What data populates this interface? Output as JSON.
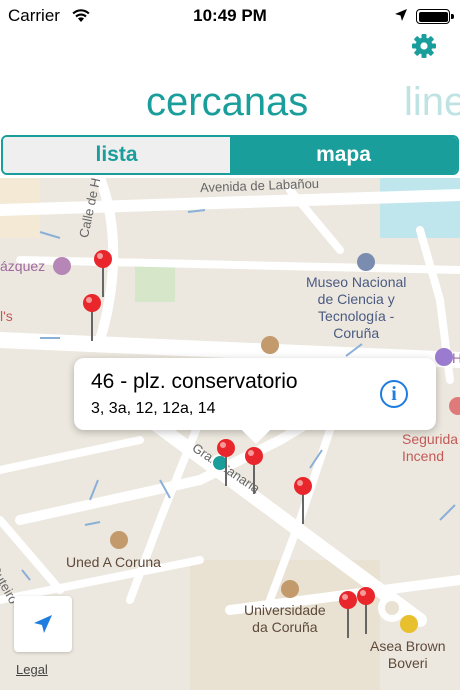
{
  "status_bar": {
    "carrier": "Carrier",
    "time": "10:49 PM"
  },
  "header": {
    "tab_current": "cercanas",
    "tab_next": "line",
    "settings_icon": "gear-icon"
  },
  "segmented": {
    "lista": "lista",
    "mapa": "mapa",
    "selected": "mapa"
  },
  "map": {
    "streets": [
      "Avenida de Labañou",
      "Calle de Honduras",
      "Gran Canaria",
      "Outeiro"
    ],
    "pois": [
      {
        "name": "Museo Nacional\nde Ciencia y\nTecnología -\nCoruña"
      },
      {
        "name": "Uned A Coruna"
      },
      {
        "name": "Universidade\nda Coruña"
      },
      {
        "name": "Asea Brown\nBoveri"
      },
      {
        "name": "Galle\nSegurida\nIncend"
      },
      {
        "name": "ázquez"
      },
      {
        "name": "l's"
      },
      {
        "name": "H"
      }
    ],
    "callout": {
      "title": "46 - plz. conservatorio",
      "lines": "3, 3a, 12, 12a, 14"
    },
    "legal": "Legal",
    "colors": {
      "accent": "#1a9e9b",
      "pin": "#e8262b",
      "info": "#1f7de0"
    }
  }
}
